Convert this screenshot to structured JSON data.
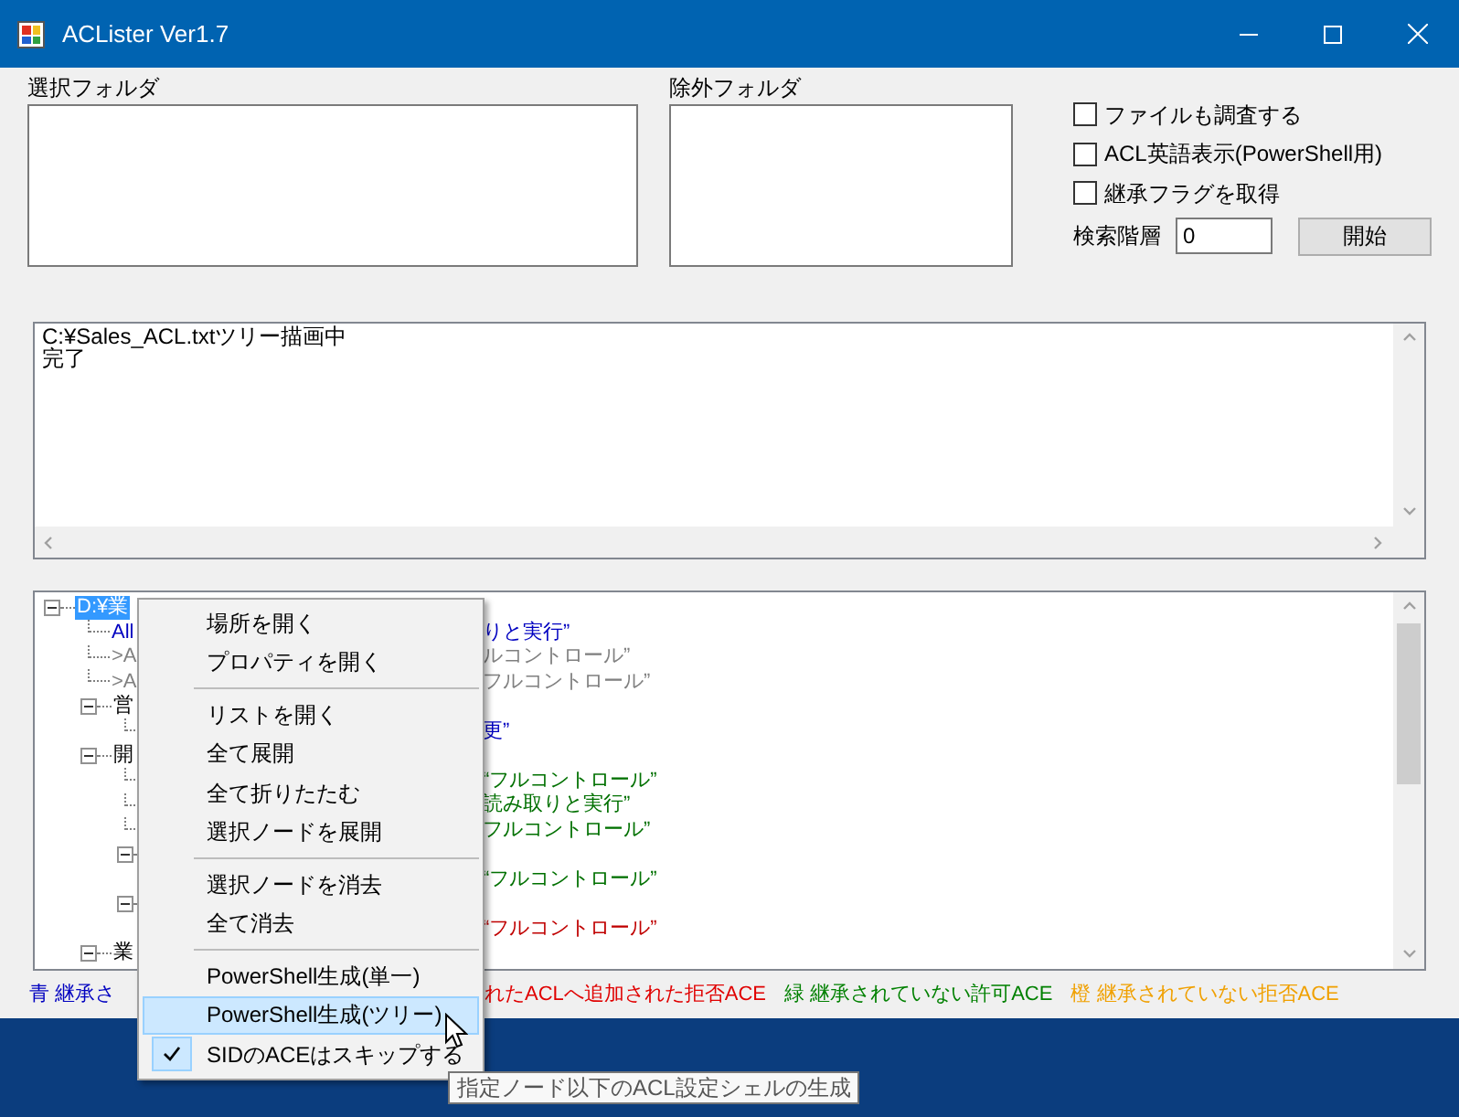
{
  "window": {
    "title": "ACLister Ver1.7"
  },
  "select_folder": {
    "label": "選択フォルダ"
  },
  "exclude_folder": {
    "label": "除外フォルダ"
  },
  "options": [
    {
      "label": "ファイルも調査する",
      "checked": false
    },
    {
      "label": "ACL英語表示(PowerShell用)",
      "checked": false
    },
    {
      "label": "継承フラグを取得",
      "checked": false
    }
  ],
  "search_depth": {
    "label": "検索階層",
    "value": "0"
  },
  "start_button": "開始",
  "log": [
    "C:¥Sales_ACL.txtツリー描画中",
    "完了"
  ],
  "tree": [
    {
      "text": "D:¥業",
      "selected": true,
      "expanded": true,
      "children": [
        {
          "text": "All",
          "tail": "りと実行”",
          "color": "#0000c0",
          "selected": false
        },
        {
          "text": ">A",
          "tail": "ルコントロール”",
          "color": "#808080",
          "selected": false
        },
        {
          "text": ">A",
          "tail": "フルコントロール”",
          "color": "#808080",
          "selected": false
        },
        {
          "text": "営",
          "color": "#000000",
          "selected": false,
          "expanded": true,
          "children": [
            {
              "tail": "更”",
              "color": "#0000c0",
              "selected": false
            }
          ]
        },
        {
          "text": "開",
          "color": "#000000",
          "selected": false,
          "expanded": true,
          "children": [
            {
              "tail": "“フルコントロール”",
              "color": "#007000",
              "selected": false
            },
            {
              "tail": "読み取りと実行”",
              "color": "#007000",
              "selected": false
            },
            {
              "tail": "フルコントロール”",
              "color": "#007000",
              "selected": false
            },
            {
              "selected": false,
              "expanded": true,
              "children": [
                {
                  "tail": "“フルコントロール”",
                  "color": "#007000",
                  "selected": false
                }
              ]
            },
            {
              "selected": false,
              "expanded": true,
              "children": [
                {
                  "tail": "“フルコントロール”",
                  "color": "#c00000",
                  "selected": false
                }
              ]
            }
          ]
        },
        {
          "text": "業",
          "color": "#000000",
          "selected": false,
          "expanded": true
        }
      ]
    }
  ],
  "legend": [
    {
      "text": "青 継承さ",
      "color": "#0000c0"
    },
    {
      "text": "れたACLへ追加された拒否ACE",
      "color": "#e00000"
    },
    {
      "text": "緑 継承されていない許可ACE",
      "color": "#008000"
    },
    {
      "text": "橙 継承されていない拒否ACE",
      "color": "#f0a000"
    }
  ],
  "context_menu": [
    {
      "kind": "item",
      "label": "場所を開く",
      "selected": false,
      "checked": false
    },
    {
      "kind": "item",
      "label": "プロパティを開く",
      "selected": false,
      "checked": false
    },
    {
      "kind": "separator"
    },
    {
      "kind": "item",
      "label": "リストを開く",
      "selected": false,
      "checked": false
    },
    {
      "kind": "item",
      "label": "全て展開",
      "selected": false,
      "checked": false
    },
    {
      "kind": "item",
      "label": "全て折りたたむ",
      "selected": false,
      "checked": false
    },
    {
      "kind": "item",
      "label": "選択ノードを展開",
      "selected": false,
      "checked": false
    },
    {
      "kind": "separator"
    },
    {
      "kind": "item",
      "label": "選択ノードを消去",
      "selected": false,
      "checked": false
    },
    {
      "kind": "item",
      "label": "全て消去",
      "selected": false,
      "checked": false
    },
    {
      "kind": "separator"
    },
    {
      "kind": "item",
      "label": "PowerShell生成(単一)",
      "selected": false,
      "checked": false
    },
    {
      "kind": "item",
      "label": "PowerShell生成(ツリー)",
      "selected": true,
      "checked": false
    },
    {
      "kind": "item",
      "label": "SIDのACEはスキップする",
      "selected": false,
      "checked": true
    }
  ],
  "tooltip": "指定ノード以下のACL設定シェルの生成"
}
